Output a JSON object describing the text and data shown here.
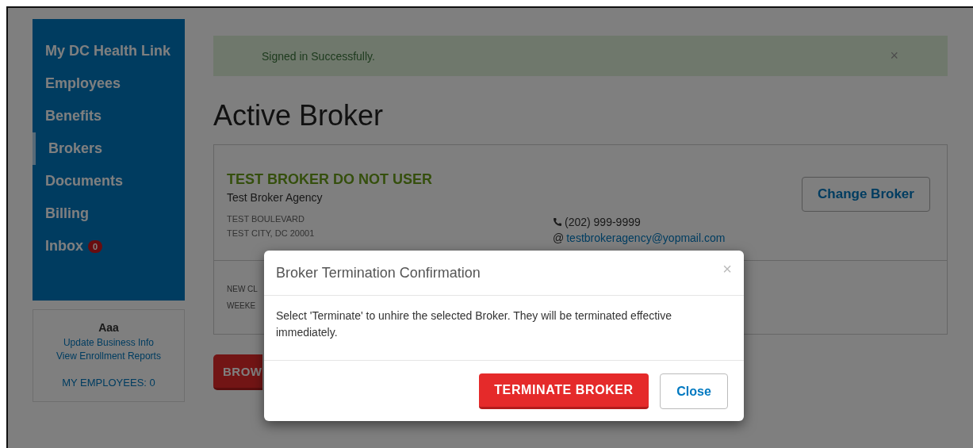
{
  "sidebar": {
    "items": [
      {
        "label": "My DC Health Link",
        "selected": false
      },
      {
        "label": "Employees",
        "selected": false
      },
      {
        "label": "Benefits",
        "selected": false
      },
      {
        "label": "Brokers",
        "selected": true
      },
      {
        "label": "Documents",
        "selected": false
      },
      {
        "label": "Billing",
        "selected": false
      },
      {
        "label": "Inbox",
        "selected": false,
        "badge": "0"
      }
    ]
  },
  "account_card": {
    "name": "Aaa",
    "links": [
      "Update Business Info",
      "View Enrollment Reports"
    ],
    "employees": "MY EMPLOYEES: 0"
  },
  "alert": {
    "message": "Signed in Successfully.",
    "close": "×"
  },
  "page_title": "Active Broker",
  "broker": {
    "name": "TEST BROKER DO NOT USER",
    "agency": "Test Broker Agency",
    "address": [
      "TEST BOULEVARD",
      "TEST CITY, DC 20001"
    ],
    "phone": "(202) 999-9999",
    "email_prefix": "@",
    "email": "testbrokeragency@yopmail.com",
    "change_button": "Change Broker",
    "details": [
      "NEW CL",
      "WEEKE"
    ]
  },
  "browse_button": "BROW",
  "modal": {
    "title": "Broker Termination Confirmation",
    "close": "×",
    "message": "Select 'Terminate' to unhire the selected Broker. They will be terminated effective immediately.",
    "buttons": [
      {
        "label": "TERMINATE BROKER",
        "kind": "danger"
      },
      {
        "label": "Close",
        "kind": "default"
      }
    ]
  }
}
